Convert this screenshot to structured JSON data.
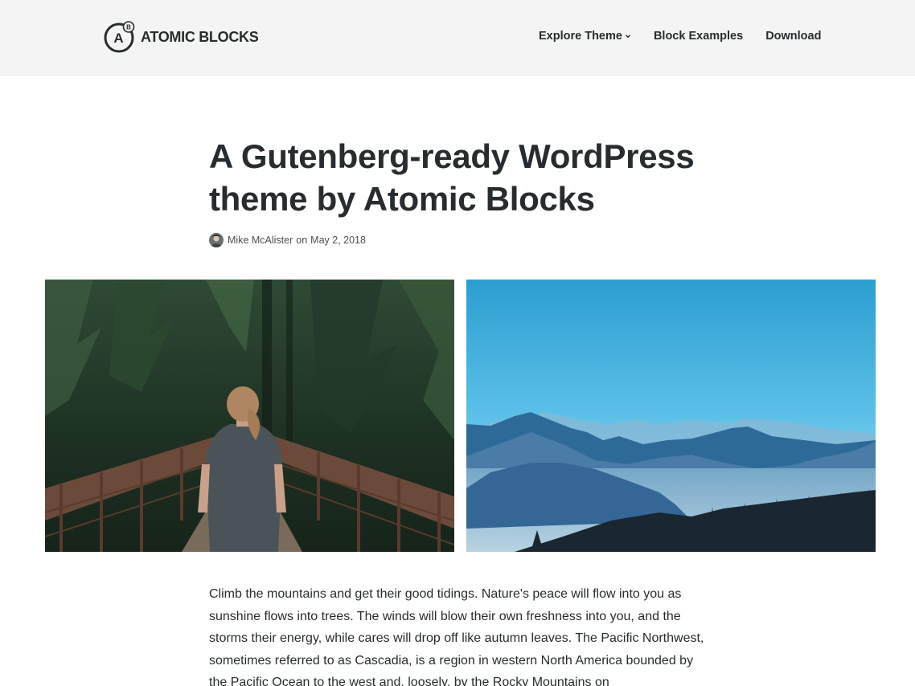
{
  "header": {
    "brand_name": "ATOMIC BLOCKS",
    "brand_mark_letter": "A",
    "brand_mark_badge": "B",
    "nav": [
      {
        "label": "Explore Theme",
        "has_dropdown": true
      },
      {
        "label": "Block Examples"
      },
      {
        "label": "Download"
      }
    ]
  },
  "post": {
    "title": "A Gutenberg-ready WordPress theme by Atomic Blocks",
    "author": "Mike McAlister",
    "date_prefix": "on",
    "date": "May 2, 2018",
    "images": [
      {
        "name": "forest-bridge-image"
      },
      {
        "name": "mountain-range-image"
      }
    ],
    "body": "Climb the mountains and get their good tidings. Nature's peace will flow into you as sunshine flows into trees. The winds will blow their own freshness into you, and the storms their energy, while cares will drop off like autumn leaves. The Pacific Northwest, sometimes referred to as Cascadia, is a region in western North America bounded by the Pacific Ocean to the west and, loosely, by the Rocky Mountains on"
  },
  "colors": {
    "header_bg": "#f4f4f4",
    "text": "#272c30",
    "meta_text": "#4a4f54"
  }
}
